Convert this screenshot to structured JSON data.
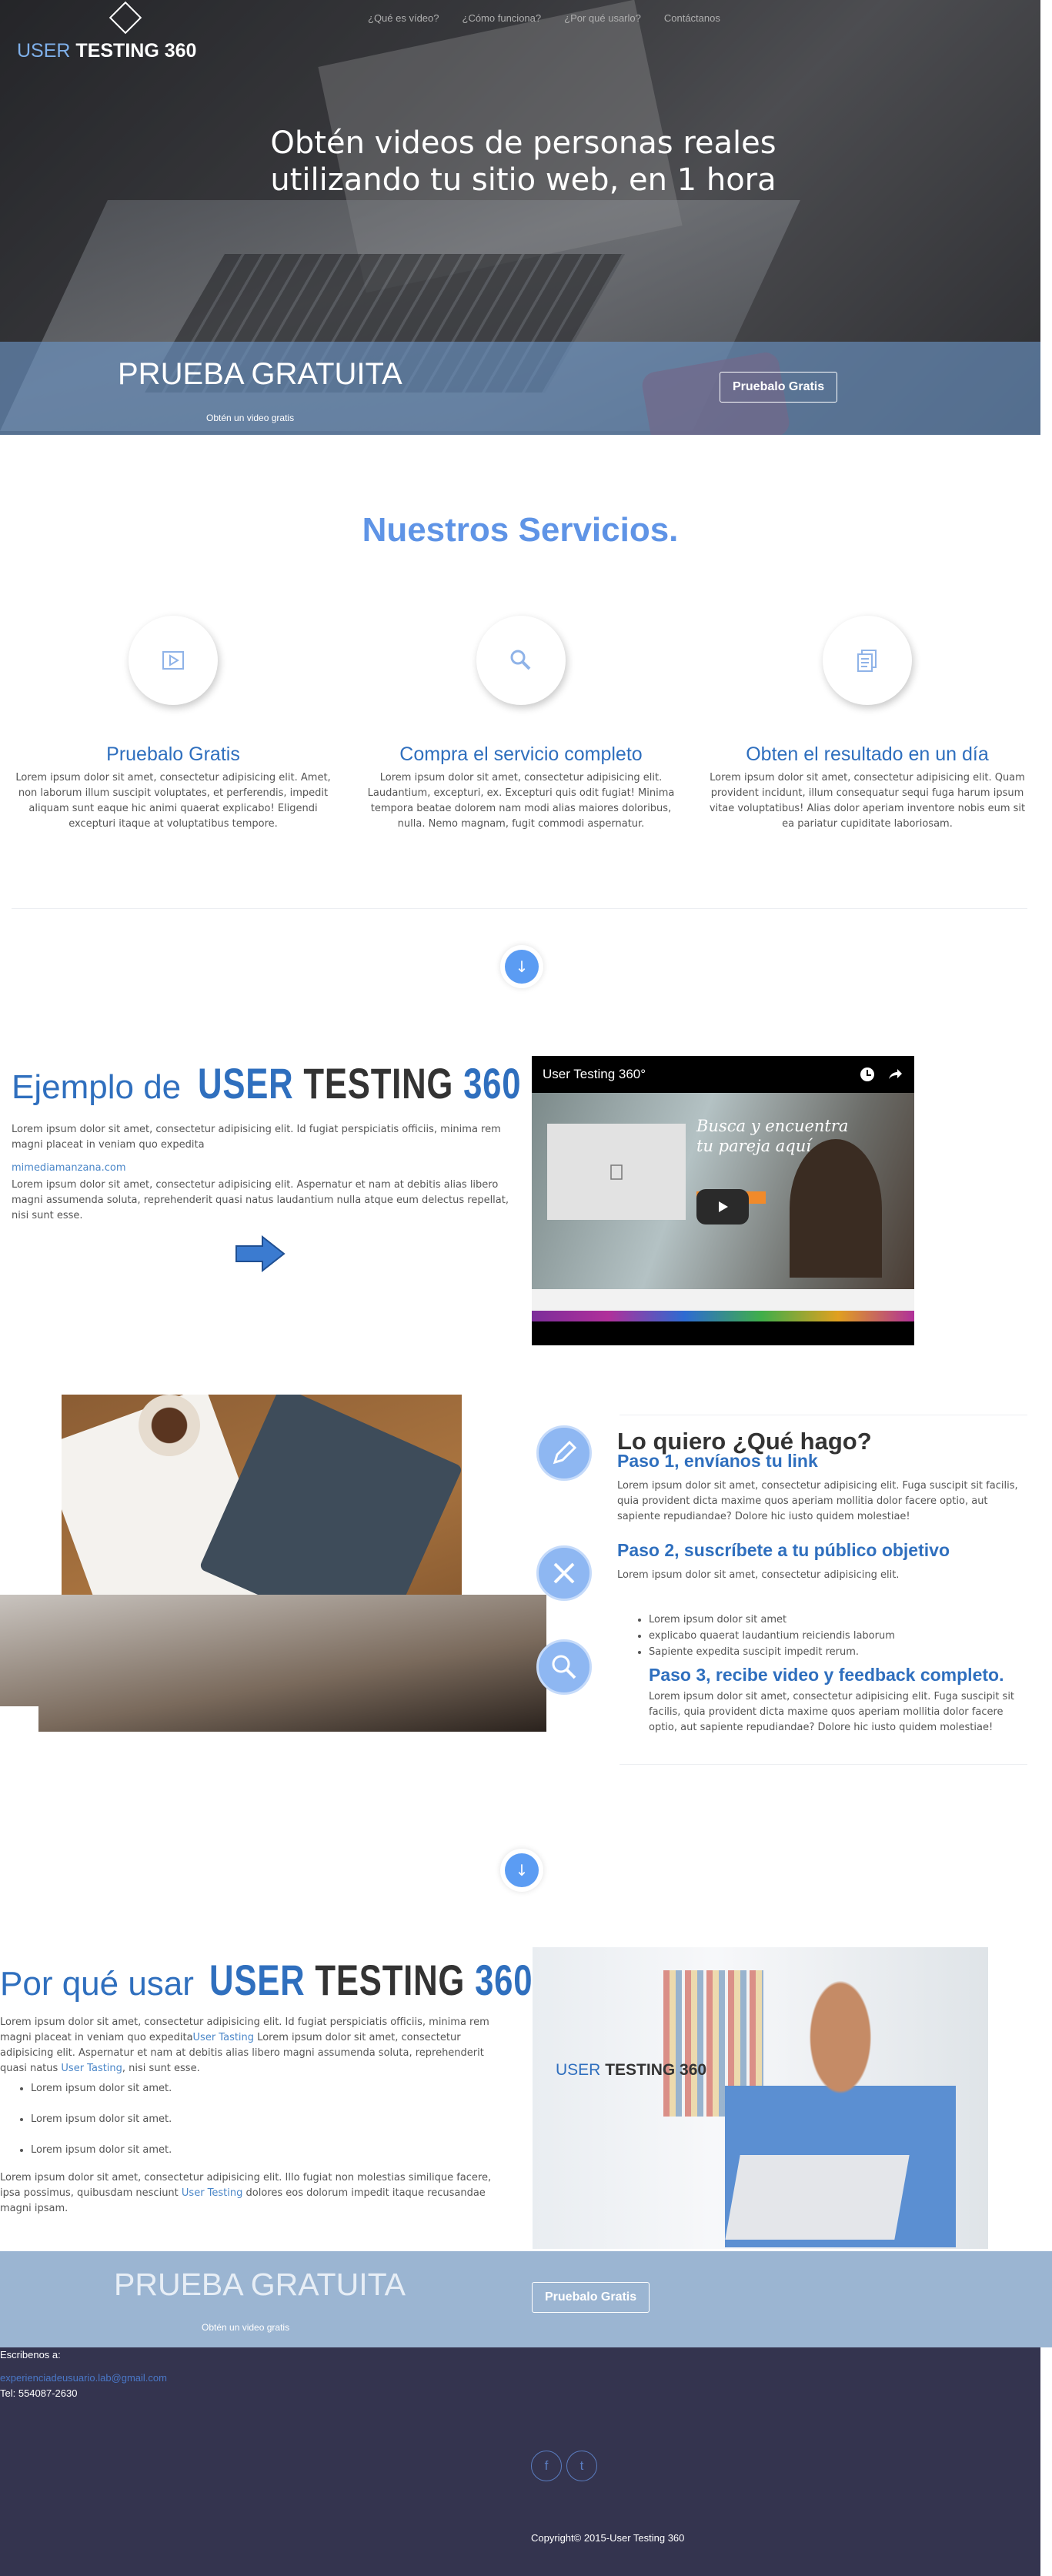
{
  "hero": {
    "logo_user": "USER",
    "logo_rest": "TESTING 360",
    "nav": [
      "¿Qué es vídeo?",
      "¿Cómo funciona?",
      "¿Por qué usarlo?",
      "Contáctanos"
    ],
    "headline_line1": "Obtén videos de personas reales",
    "headline_line2": "utilizando tu sitio web, en 1 hora",
    "cta_title": "PRUEBA GRATUITA",
    "cta_sub": "Obtén un video gratis",
    "cta_button": "Pruebalo Gratis"
  },
  "services": {
    "title": "Nuestros Servicios.",
    "items": [
      {
        "icon": "video-icon",
        "title": "Pruebalo Gratis",
        "text": "Lorem ipsum dolor sit amet, consectetur adipisicing elit. Amet, non laborum illum suscipit voluptates, et perferendis, impedit aliquam sunt eaque hic animi quaerat explicabo! Eligendi excepturi itaque at voluptatibus tempore."
      },
      {
        "icon": "search-icon",
        "title": "Compra el servicio completo",
        "text": "Lorem ipsum dolor sit amet, consectetur adipisicing elit. Laudantium, excepturi, ex. Excepturi quis odit fugiat! Minima tempora beatae dolorem nam modi alias maiores doloribus, nulla. Nemo magnam, fugit commodi aspernatur."
      },
      {
        "icon": "document-icon",
        "title": "Obten el resultado en un día",
        "text": "Lorem ipsum dolor sit amet, consectetur adipisicing elit. Quam provident incidunt, illum consequatur sequi fuga harum ipsum vitae voluptatibus! Alias dolor aperiam inventore nobis eum sit ea pariatur cupiditate laboriosam."
      }
    ]
  },
  "example": {
    "prefix": "Ejemplo de",
    "brand_user": "USER",
    "brand_testing": "TESTING",
    "brand_num": "360",
    "p1": "Lorem ipsum dolor sit amet, consectetur adipisicing elit. Id fugiat perspiciatis officiis, minima rem magni placeat in veniam quo expedita",
    "link": "mimediamanzana.com",
    "p2": "Lorem ipsum dolor sit amet, consectetur adipisicing elit. Aspernatur et nam at debitis alias libero magni assumenda soluta, reprehenderit quasi natus laudantium nulla atque eum delectus repellat, nisi sunt esse.",
    "video_title": "User Testing 360°",
    "video_headline_1": "Busca y encuentra",
    "video_headline_2": "tu pareja aquí"
  },
  "how": {
    "title": "Lo quiero ¿Qué hago?",
    "step1_title": "Paso 1, envíanos tu link",
    "step1_text": "Lorem ipsum dolor sit amet, consectetur adipisicing elit. Fuga suscipit sit facilis, quia provident dicta maxime quos aperiam mollitia dolor facere optio, aut sapiente repudiandae? Dolore hic iusto quidem molestiae!",
    "step2_title": "Paso 2, suscríbete a tu público objetivo",
    "step2_text": "Lorem ipsum dolor sit amet, consectetur adipisicing elit.",
    "step2_list": [
      "Lorem ipsum dolor sit amet",
      "explicabo quaerat laudantium reiciendis laborum",
      "Sapiente expedita suscipit impedit rerum."
    ],
    "step3_title": "Paso 3, recibe video y feedback completo.",
    "step3_text": "Lorem ipsum dolor sit amet, consectetur adipisicing elit. Fuga suscipit sit facilis, quia provident dicta maxime quos aperiam mollitia dolor facere optio, aut sapiente repudiandae? Dolore hic iusto quidem molestiae!"
  },
  "why": {
    "prefix": "Por qué usar",
    "brand_user": "USER",
    "brand_testing": "TESTING",
    "brand_num": "360",
    "p1_a": "Lorem ipsum dolor sit amet, consectetur adipisicing elit. Id fugiat perspiciatis officiis, minima rem magni placeat in veniam quo expedita",
    "p1_link1": "User Tasting",
    "p1_b": " Lorem ipsum dolor sit amet, consectetur adipisicing elit. Aspernatur et nam at debitis alias libero magni assumenda soluta, reprehenderit quasi natus ",
    "p1_link2": "User Tasting",
    "p1_c": ", nisi sunt esse.",
    "list": [
      "Lorem ipsum dolor sit amet.",
      "Lorem ipsum dolor sit amet.",
      "Lorem ipsum dolor sit amet."
    ],
    "p2_a": "Lorem ipsum dolor sit amet, consectetur adipisicing elit. Illo fugiat non molestias similique facere, ipsa possimus, quibusdam nesciunt ",
    "p2_link": "User Testing",
    "p2_b": " dolores eos dolorum impedit itaque recusandae magni ipsam.",
    "img_logo_user": "USER",
    "img_logo_rest": "TESTING 360"
  },
  "cta2": {
    "title": "PRUEBA GRATUITA",
    "sub": "Obtén un video gratis",
    "button": "Pruebalo Gratis"
  },
  "footer": {
    "label": "Escribenos a:",
    "email": "experienciadeusuario.lab@gmail.com",
    "tel": "Tel: 554087-2630",
    "social": [
      "f",
      "t"
    ],
    "copyright": "Copyright© 2015-User Testing 360"
  },
  "colors": {
    "accent": "#2f6fbe",
    "services_title": "#5f94e6",
    "footer_bg": "#34344f",
    "cta_band": "#9bb5d2"
  }
}
